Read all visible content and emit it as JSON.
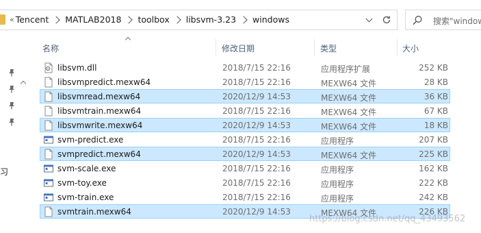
{
  "address_bar": {
    "overflow_glyph": "«",
    "breadcrumbs": [
      "Tencent",
      "MATLAB2018",
      "toolbox",
      "libsvm-3.23",
      "windows"
    ]
  },
  "search": {
    "placeholder": "搜索\"windows\""
  },
  "nav": {
    "partial_text": "习"
  },
  "columns": {
    "name": "名称",
    "date": "修改日期",
    "type": "类型",
    "size": "大小"
  },
  "files": [
    {
      "name": "libsvm.dll",
      "date": "2018/7/15 22:16",
      "type": "应用程序扩展",
      "size": "252 KB",
      "icon": "dll-icon",
      "selected": false
    },
    {
      "name": "libsvmpredict.mexw64",
      "date": "2018/7/15 22:16",
      "type": "MEXW64 文件",
      "size": "28 KB",
      "icon": "file-icon",
      "selected": false
    },
    {
      "name": "libsvmread.mexw64",
      "date": "2020/12/9 14:53",
      "type": "MEXW64 文件",
      "size": "36 KB",
      "icon": "file-icon",
      "selected": true
    },
    {
      "name": "libsvmtrain.mexw64",
      "date": "2018/7/15 22:16",
      "type": "MEXW64 文件",
      "size": "67 KB",
      "icon": "file-icon",
      "selected": false
    },
    {
      "name": "libsvmwrite.mexw64",
      "date": "2020/12/9 14:53",
      "type": "MEXW64 文件",
      "size": "18 KB",
      "icon": "file-icon",
      "selected": true
    },
    {
      "name": "svm-predict.exe",
      "date": "2018/7/15 22:16",
      "type": "应用程序",
      "size": "207 KB",
      "icon": "exe-icon",
      "selected": false
    },
    {
      "name": "svmpredict.mexw64",
      "date": "2020/12/9 14:53",
      "type": "MEXW64 文件",
      "size": "225 KB",
      "icon": "file-icon",
      "selected": true
    },
    {
      "name": "svm-scale.exe",
      "date": "2018/7/15 22:16",
      "type": "应用程序",
      "size": "162 KB",
      "icon": "exe-icon",
      "selected": false
    },
    {
      "name": "svm-toy.exe",
      "date": "2018/7/15 22:16",
      "type": "应用程序",
      "size": "222 KB",
      "icon": "exe-icon",
      "selected": false
    },
    {
      "name": "svm-train.exe",
      "date": "2018/7/15 22:16",
      "type": "应用程序",
      "size": "242 KB",
      "icon": "exe-icon",
      "selected": false
    },
    {
      "name": "svmtrain.mexw64",
      "date": "2020/12/9 14:53",
      "type": "MEXW64 文件",
      "size": "226 KB",
      "icon": "file-icon",
      "selected": true
    }
  ],
  "watermark": "https://blog.csdn.net/qq_43493562",
  "colors": {
    "selection_bg": "#cce8ff",
    "selection_border": "#99d1ff",
    "header_text": "#4c607a"
  }
}
